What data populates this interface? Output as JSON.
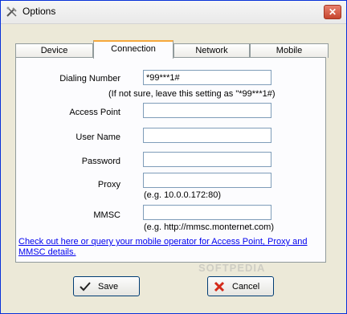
{
  "window": {
    "title": "Options",
    "close_label": "✕"
  },
  "tabs": [
    {
      "label": "Device",
      "active": false
    },
    {
      "label": "Connection",
      "active": true
    },
    {
      "label": "Network",
      "active": false
    },
    {
      "label": "Mobile",
      "active": false
    }
  ],
  "form": {
    "dialing_number": {
      "label": "Dialing Number",
      "value": "*99***1#",
      "hint": "(If not sure, leave this setting as \"*99***1#)"
    },
    "access_point": {
      "label": "Access Point",
      "value": ""
    },
    "user_name": {
      "label": "User Name",
      "value": ""
    },
    "password": {
      "label": "Password",
      "value": ""
    },
    "proxy": {
      "label": "Proxy",
      "value": "",
      "hint": "(e.g. 10.0.0.172:80)"
    },
    "mmsc": {
      "label": "MMSC",
      "value": "",
      "hint": "(e.g. http://mmsc.monternet.com)"
    }
  },
  "help_link": "Check out here or query your mobile operator for Access Point, Proxy and MMSC details.",
  "buttons": {
    "save": {
      "label": "Save",
      "icon": "checkmark-icon"
    },
    "cancel": {
      "label": "Cancel",
      "icon": "red-x-icon"
    }
  },
  "watermark": "SOFTPEDIA",
  "colors": {
    "link": "#0000ee",
    "tab_highlight": "#f6a83c",
    "cancel_icon": "#d42a1a"
  }
}
